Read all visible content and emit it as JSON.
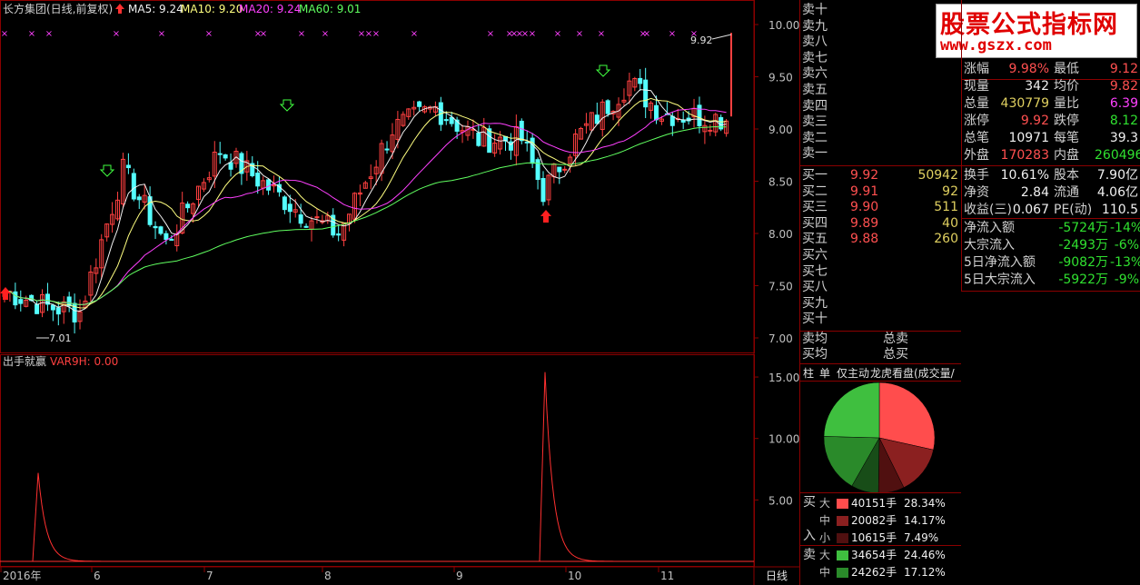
{
  "header": {
    "stock": "长方集团(日线,前复权)",
    "ma5": "MA5: 9.24",
    "ma10": "MA10: 9.20",
    "ma20": "MA20: 9.24",
    "ma60": "MA60: 9.01"
  },
  "indicator": {
    "name": "出手就赢",
    "var": "VAR9H: 0.00"
  },
  "price_axis": [
    "10.00",
    "9.50",
    "9.00",
    "8.50",
    "8.00",
    "7.50",
    "7.00"
  ],
  "ind_axis": [
    "15.00",
    "10.00",
    "5.00"
  ],
  "price_labels": {
    "high": "9.92",
    "low": "7.01"
  },
  "x_axis": [
    "2016年",
    "6",
    "7",
    "8",
    "9",
    "10",
    "11"
  ],
  "period_label": "日线",
  "logo": {
    "title": "股票公式指标网",
    "url": "www.gszx.com"
  },
  "asks": [
    "卖十",
    "卖九",
    "卖八",
    "卖七",
    "卖六",
    "卖五",
    "卖四",
    "卖三",
    "卖二",
    "卖一"
  ],
  "bids": [
    {
      "label": "买一",
      "price": "9.92",
      "vol": "50942"
    },
    {
      "label": "买二",
      "price": "9.91",
      "vol": "92"
    },
    {
      "label": "买三",
      "price": "9.90",
      "vol": "511"
    },
    {
      "label": "买四",
      "price": "9.89",
      "vol": "40"
    },
    {
      "label": "买五",
      "price": "9.88",
      "vol": "260"
    },
    {
      "label": "买六",
      "price": "",
      "vol": ""
    },
    {
      "label": "买七",
      "price": "",
      "vol": ""
    },
    {
      "label": "买八",
      "price": "",
      "vol": ""
    },
    {
      "label": "买九",
      "price": "",
      "vol": ""
    },
    {
      "label": "买十",
      "price": "",
      "vol": ""
    }
  ],
  "avg": {
    "sell_avg": "卖均",
    "buy_avg": "买均",
    "total_sell": "总卖",
    "total_buy": "总买"
  },
  "quote": [
    {
      "l1": "涨幅",
      "v1": "9.98%",
      "c1": "red",
      "l2": "最低",
      "v2": "9.12",
      "c2": "red"
    },
    {
      "l1": "现量",
      "v1": "342",
      "c1": "wht",
      "l2": "均价",
      "v2": "9.82",
      "c2": "red"
    },
    {
      "l1": "总量",
      "v1": "430779",
      "c1": "yel",
      "l2": "量比",
      "v2": "6.39",
      "c2": "mag"
    },
    {
      "l1": "涨停",
      "v1": "9.92",
      "c1": "red",
      "l2": "跌停",
      "v2": "8.12",
      "c2": "grn"
    },
    {
      "l1": "总笔",
      "v1": "10971",
      "c1": "wht",
      "l2": "每笔",
      "v2": "39.3",
      "c2": "wht"
    },
    {
      "l1": "外盘",
      "v1": "170283",
      "c1": "red",
      "l2": "内盘",
      "v2": "260496",
      "c2": "grn"
    }
  ],
  "quote2": [
    {
      "l1": "换手",
      "v1": "10.61%",
      "l2": "股本",
      "v2": "7.90亿"
    },
    {
      "l1": "净资",
      "v1": "2.84",
      "l2": "流通",
      "v2": "4.06亿"
    },
    {
      "l1": "收益(三)",
      "v1": "0.067",
      "l2": "PE(动)",
      "v2": "110.5"
    }
  ],
  "flows": [
    {
      "l": "净流入额",
      "v": "-5724万",
      "p": "-14%"
    },
    {
      "l": "大宗流入",
      "v": "-2493万",
      "p": "-6%"
    },
    {
      "l": "5日净流入额",
      "v": "-9082万",
      "p": "-13%"
    },
    {
      "l": "5日大宗流入",
      "v": "-5922万",
      "p": "-9%"
    }
  ],
  "tabs": [
    "柱",
    "单",
    "仅主动",
    "龙虎看盘(成交量/按"
  ],
  "pie": [
    {
      "value": 28.34,
      "color": "#ff4d4d"
    },
    {
      "value": 14.17,
      "color": "#8b2020"
    },
    {
      "value": 7.49,
      "color": "#501010"
    },
    {
      "value": 7.97,
      "color": "#184d18"
    },
    {
      "value": 17.12,
      "color": "#2a8a2a"
    },
    {
      "value": 24.46,
      "color": "#3fbf3f"
    }
  ],
  "buy_side": {
    "label_top": "买",
    "label_bot": "入",
    "rows": [
      {
        "size": "大",
        "vol": "40151手",
        "pct": "28.34%",
        "color": "#ff4d4d"
      },
      {
        "size": "中",
        "vol": "20082手",
        "pct": "14.17%",
        "color": "#8b2020"
      },
      {
        "size": "小",
        "vol": "10615手",
        "pct": "7.49%",
        "color": "#501010"
      }
    ]
  },
  "sell_side": {
    "label": "卖",
    "rows": [
      {
        "size": "大",
        "vol": "34654手",
        "pct": "24.46%",
        "color": "#3fbf3f"
      },
      {
        "size": "中",
        "vol": "24262手",
        "pct": "17.12%",
        "color": "#2a8a2a"
      }
    ]
  }
}
